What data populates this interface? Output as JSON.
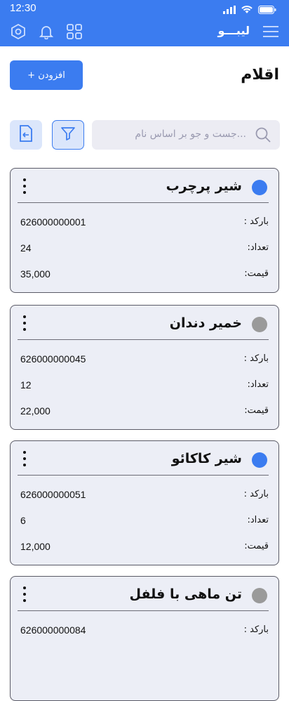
{
  "status": {
    "time": "12:30"
  },
  "appbar": {
    "brand": "لیبـــو"
  },
  "page": {
    "title": "اقلام",
    "add_label": "+ افزودن"
  },
  "search": {
    "placeholder": "جست و جو بر اساس نام..."
  },
  "labels": {
    "barcode": "بارکد :",
    "count": "تعداد:",
    "price": "قیمت:"
  },
  "items": [
    {
      "name": "شیر پرچرب",
      "barcode": "626000000001",
      "count": "24",
      "price": "35,000",
      "status_color": "#3b7cf0"
    },
    {
      "name": "خمیر دندان",
      "barcode": "626000000045",
      "count": "12",
      "price": "22,000",
      "status_color": "#9a9a9a"
    },
    {
      "name": "شیر کاکائو",
      "barcode": "626000000051",
      "count": "6",
      "price": "12,000",
      "status_color": "#3b7cf0"
    },
    {
      "name": "تن ماهی با فلفل",
      "barcode": "626000000084",
      "count": "",
      "price": "",
      "status_color": "#9a9a9a"
    }
  ]
}
